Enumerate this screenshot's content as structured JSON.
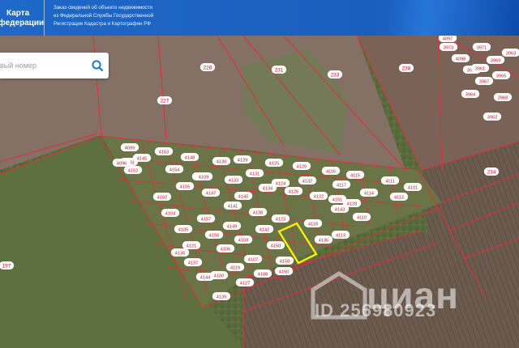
{
  "header": {
    "brand_line1": "Карта",
    "brand_line2": "федерации",
    "notice_line1": "Заказ сведений об объекте недвижимости",
    "notice_line2": "из Федеральной Службы Государственной",
    "notice_line3": "Регистрации Кадастра и Картографии РФ"
  },
  "search": {
    "placeholder": "вый номер",
    "icon": "search-icon"
  },
  "watermark": {
    "brand": "циан",
    "id": "ID 256980923",
    "icon": "cian-house-logo-icon"
  },
  "colors": {
    "header_blue": "#1f68c7",
    "parcel_border": "#e0303a",
    "selected_parcel": "#f5f000",
    "label_bg": "#ffffff",
    "label_text": "#c4141c"
  },
  "large_parcels": [
    "228",
    "231",
    "233",
    "238",
    "227",
    "234",
    "197"
  ],
  "plots": [
    "4099",
    "4153",
    "4148",
    "4130",
    "4129",
    "4125",
    "4120",
    "4116",
    "4115",
    "4111",
    "4103",
    "4154",
    "4146",
    "4133",
    "4131",
    "4124",
    "4132",
    "4114",
    "4112",
    "4101",
    "4102",
    "4155",
    "4147",
    "4140",
    "4134",
    "4126",
    "4122",
    "4117",
    "4110",
    "4096",
    "4104",
    "4157",
    "4141",
    "4138",
    "4123",
    "4118",
    "4113",
    "4105",
    "4156",
    "4149",
    "4142",
    "4136",
    "4128",
    "4121",
    "4106",
    "4159",
    "4150",
    "4143",
    "4137",
    "4119",
    "4107",
    "4158",
    "4151",
    "4144",
    "4127",
    "4108",
    "4160",
    "4152",
    "4145",
    "4135",
    "4139",
    "4109",
    "4100",
    "4097",
    "4098",
    "3971",
    "3969",
    "3966",
    "3967",
    "3965",
    "3964",
    "3968",
    "3962",
    "3973",
    "3963",
    "3961",
    "3970",
    "3972"
  ],
  "selected_plot": "4134"
}
